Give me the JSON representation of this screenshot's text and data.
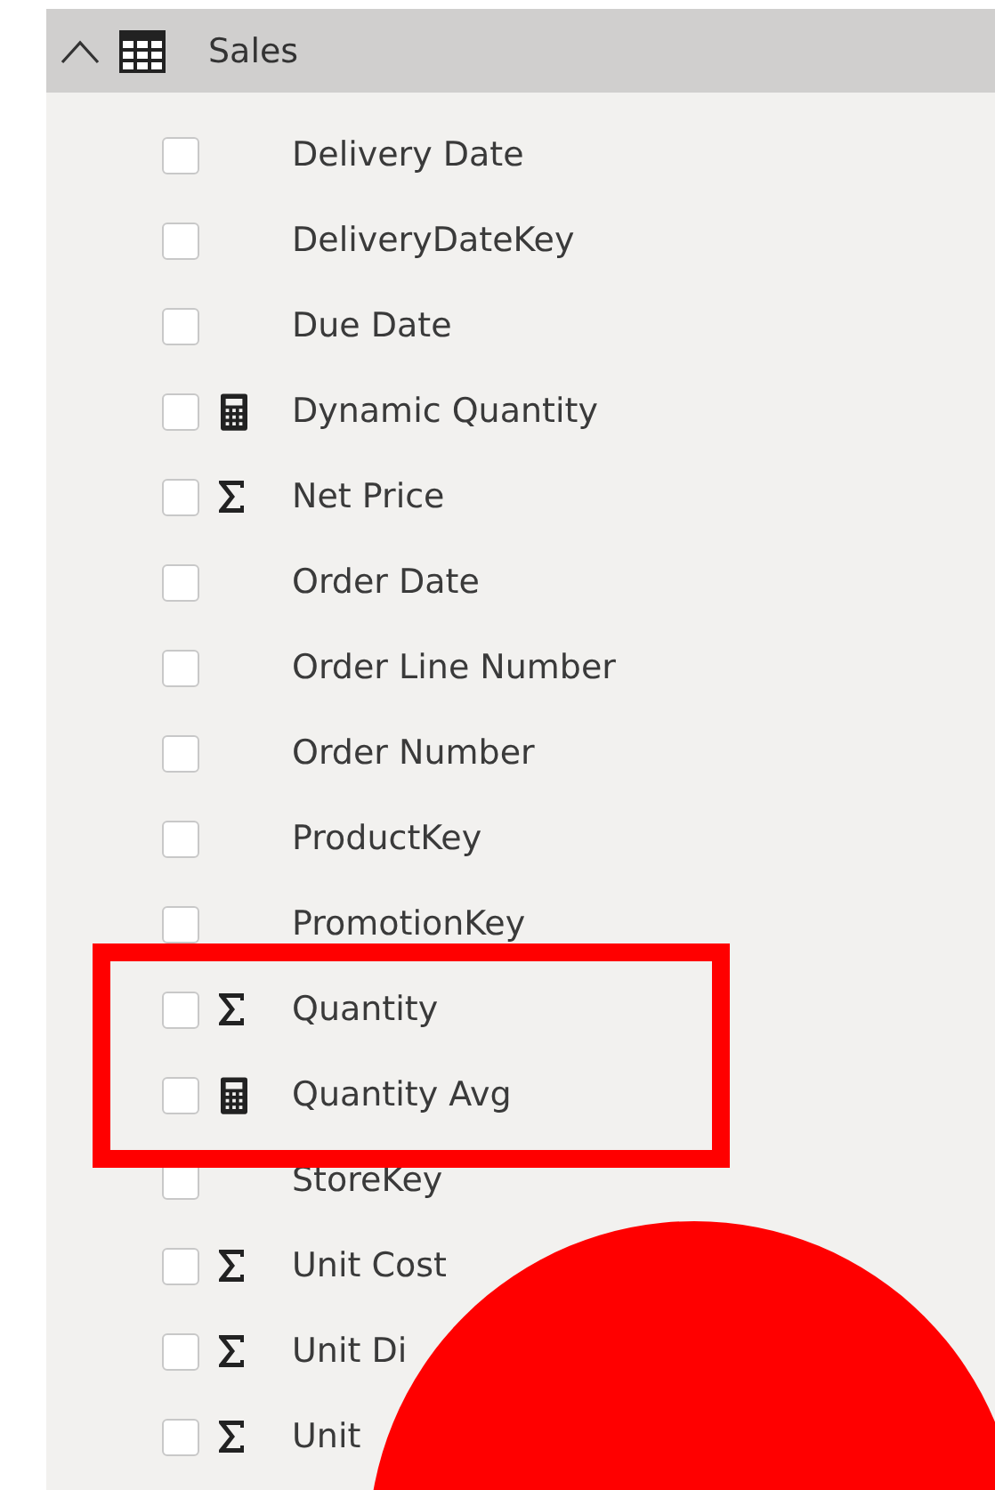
{
  "table": {
    "name": "Sales",
    "expanded": true
  },
  "fields": [
    {
      "label": "Delivery Date",
      "kind": "plain",
      "checked": false
    },
    {
      "label": "DeliveryDateKey",
      "kind": "plain",
      "checked": false
    },
    {
      "label": "Due Date",
      "kind": "plain",
      "checked": false
    },
    {
      "label": "Dynamic Quantity",
      "kind": "measure",
      "checked": false
    },
    {
      "label": "Net Price",
      "kind": "sum",
      "checked": false
    },
    {
      "label": "Order Date",
      "kind": "plain",
      "checked": false
    },
    {
      "label": "Order Line Number",
      "kind": "plain",
      "checked": false
    },
    {
      "label": "Order Number",
      "kind": "plain",
      "checked": false
    },
    {
      "label": "ProductKey",
      "kind": "plain",
      "checked": false
    },
    {
      "label": "PromotionKey",
      "kind": "plain",
      "checked": false
    },
    {
      "label": "Quantity",
      "kind": "sum",
      "checked": false
    },
    {
      "label": "Quantity Avg",
      "kind": "measure",
      "checked": false
    },
    {
      "label": "StoreKey",
      "kind": "plain",
      "checked": false
    },
    {
      "label": "Unit Cost",
      "kind": "sum",
      "checked": false
    },
    {
      "label": "Unit Di",
      "kind": "sum",
      "checked": false
    },
    {
      "label": "Unit",
      "kind": "sum",
      "checked": false
    }
  ]
}
